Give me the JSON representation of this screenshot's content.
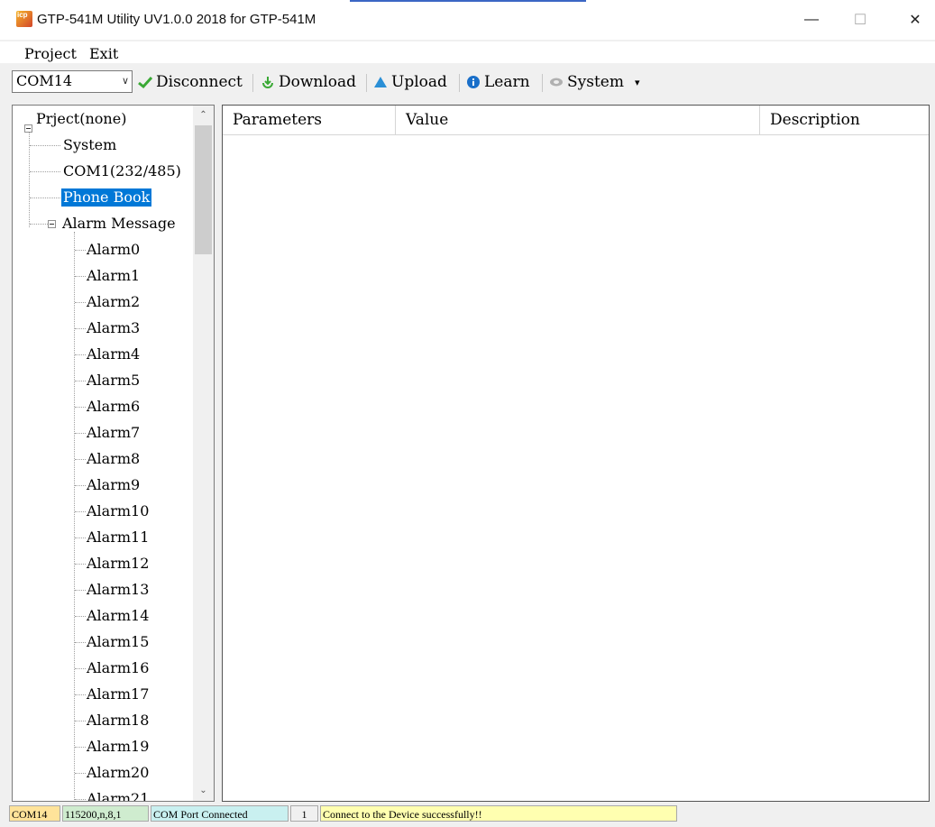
{
  "window": {
    "title": "GTP-541M Utility UV1.0.0 2018 for GTP-541M",
    "app_icon": "icp-das-logo-icon",
    "minimize_glyph": "—",
    "maximize_glyph": "☐",
    "close_glyph": "✕"
  },
  "menu": [
    "Project",
    "Exit"
  ],
  "toolbar": {
    "port_value": "COM14",
    "buttons": [
      {
        "label": "Disconnect",
        "icon": "checkmark-icon",
        "color": "#3aa935"
      },
      {
        "label": "Download",
        "icon": "download-icon",
        "color": "#3aa935"
      },
      {
        "label": "Upload",
        "icon": "upload-icon",
        "color": "#2a8fd6"
      },
      {
        "label": "Learn",
        "icon": "info-icon",
        "color": "#1a6fc9"
      },
      {
        "label": "System",
        "icon": "gear-icon",
        "color": "#888888"
      }
    ],
    "system_dropdown": "▾"
  },
  "tree": {
    "root": "Prject(none)",
    "children": [
      "System",
      "COM1(232/485)",
      "Phone Book"
    ],
    "selected": "Phone Book",
    "alarm_group": "Alarm Message",
    "alarms": [
      "Alarm0",
      "Alarm1",
      "Alarm2",
      "Alarm3",
      "Alarm4",
      "Alarm5",
      "Alarm6",
      "Alarm7",
      "Alarm8",
      "Alarm9",
      "Alarm10",
      "Alarm11",
      "Alarm12",
      "Alarm13",
      "Alarm14",
      "Alarm15",
      "Alarm16",
      "Alarm17",
      "Alarm18",
      "Alarm19",
      "Alarm20",
      "Alarm21"
    ]
  },
  "grid": {
    "columns": [
      "Parameters",
      "Value",
      "Description"
    ],
    "rows": []
  },
  "status": {
    "port": "COM14",
    "settings": "115200,n,8,1",
    "connection": "COM Port Connected",
    "count": "1",
    "message": "Connect to the Device successfully!!"
  },
  "colors": {
    "selection": "#0078d7",
    "status_settings_bg": "#cfeccf",
    "status_connection_bg": "#c9f0f0",
    "status_message_bg": "#ffffb0",
    "status_port_bg": "#ffe39a"
  }
}
